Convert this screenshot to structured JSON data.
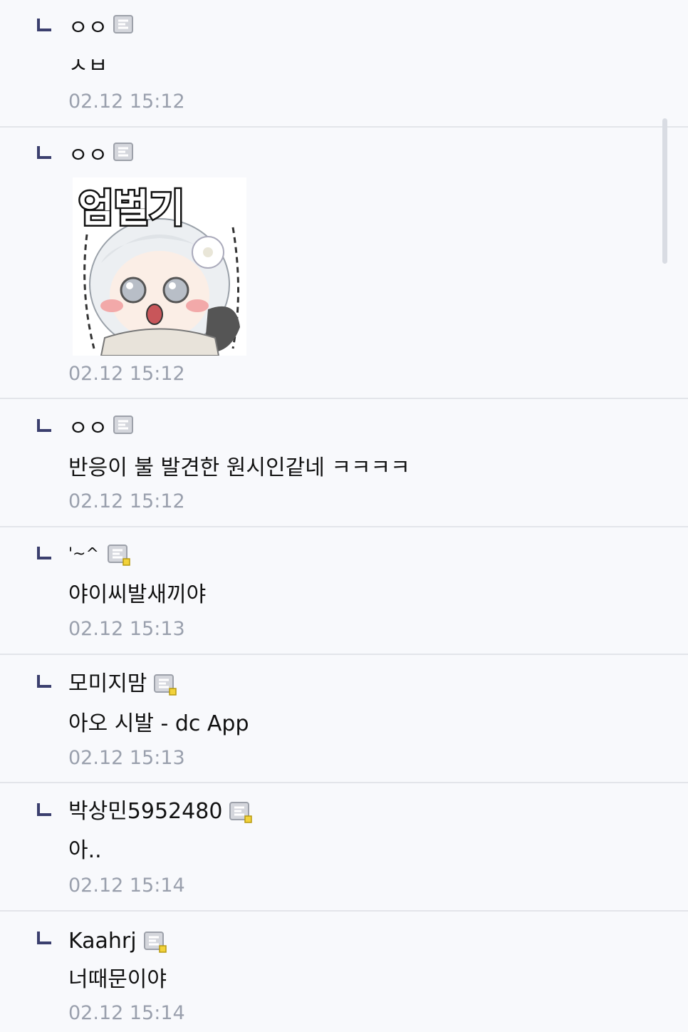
{
  "comments": [
    {
      "author": "ㅇㅇ",
      "body": "ㅅㅂ",
      "time": "02.12 15:12",
      "badge": "fixed-nick-gray-icon"
    },
    {
      "author": "ㅇㅇ",
      "body": "",
      "sticker_text": "엄벌기",
      "time": "02.12 15:12",
      "badge": "fixed-nick-gray-icon"
    },
    {
      "author": "ㅇㅇ",
      "body": "반응이 불 발견한 원시인같네 ㅋㅋㅋㅋ",
      "time": "02.12 15:12",
      "badge": "fixed-nick-gray-icon"
    },
    {
      "author": "'~^",
      "body": "야이씨발새끼야",
      "time": "02.12 15:13",
      "badge": "half-fixed-nick-icon"
    },
    {
      "author": "모미지맘",
      "body": "아오 시발 - dc App",
      "time": "02.12 15:13",
      "badge": "half-fixed-nick-icon"
    },
    {
      "author": "박상민5952480",
      "body": "아..",
      "time": "02.12 15:14",
      "badge": "half-fixed-nick-icon"
    },
    {
      "author": "Kaahrj",
      "body": "너때문이야",
      "time": "02.12 15:14",
      "badge": "half-fixed-nick-icon"
    }
  ],
  "colors": {
    "reply_mark": "#3b3f6e",
    "time": "#9aa0ad",
    "divider": "#e3e5ea",
    "background": "#f8f9fc"
  }
}
